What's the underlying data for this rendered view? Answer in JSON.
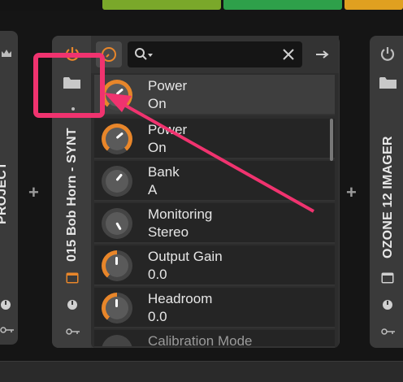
{
  "colors": {
    "accent_orange": "#e8862a",
    "annotation_pink": "#f0336f",
    "top_green_light": "#7aa82a",
    "top_green": "#2ea04a",
    "top_orange": "#e0a020"
  },
  "left_device": {
    "title": "PROJECT",
    "add": "+"
  },
  "center_device": {
    "title": "015 Bob Horn - SYNT",
    "power_icon": "power-icon",
    "browse_icon": "folder-icon"
  },
  "browser": {
    "search_placeholder": "",
    "items": [
      {
        "name": "Power",
        "value": "On",
        "knob": "orange"
      },
      {
        "name": "Power",
        "value": "On",
        "knob": "orange"
      },
      {
        "name": "Bank",
        "value": "A",
        "knob": "gray"
      },
      {
        "name": "Monitoring",
        "value": "Stereo",
        "knob": "gray"
      },
      {
        "name": "Output Gain",
        "value": "0.0",
        "knob": "orange"
      },
      {
        "name": "Headroom",
        "value": "0.0",
        "knob": "orange"
      },
      {
        "name": "Calibration Mode",
        "value": "",
        "knob": "gray"
      }
    ]
  },
  "right_device": {
    "title": "OZONE 12 IMAGER",
    "add": "+"
  }
}
